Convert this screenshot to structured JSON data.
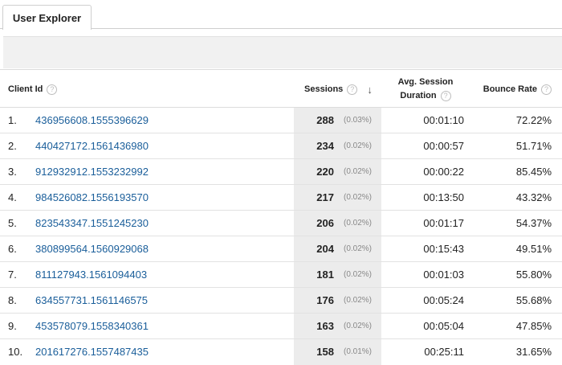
{
  "tabs": [
    {
      "label": "User Explorer"
    }
  ],
  "table": {
    "columns": {
      "client_id": "Client Id",
      "sessions": "Sessions",
      "avg_duration_line1": "Avg. Session",
      "avg_duration_line2": "Duration",
      "bounce_rate": "Bounce Rate"
    },
    "help_glyph": "?",
    "sort_glyph": "↓",
    "rows": [
      {
        "index": "1.",
        "client_id": "436956608.1555396629",
        "sessions": "288",
        "pct": "(0.03%)",
        "avg_duration": "00:01:10",
        "bounce_rate": "72.22%"
      },
      {
        "index": "2.",
        "client_id": "440427172.1561436980",
        "sessions": "234",
        "pct": "(0.02%)",
        "avg_duration": "00:00:57",
        "bounce_rate": "51.71%"
      },
      {
        "index": "3.",
        "client_id": "912932912.1553232992",
        "sessions": "220",
        "pct": "(0.02%)",
        "avg_duration": "00:00:22",
        "bounce_rate": "85.45%"
      },
      {
        "index": "4.",
        "client_id": "984526082.1556193570",
        "sessions": "217",
        "pct": "(0.02%)",
        "avg_duration": "00:13:50",
        "bounce_rate": "43.32%"
      },
      {
        "index": "5.",
        "client_id": "823543347.1551245230",
        "sessions": "206",
        "pct": "(0.02%)",
        "avg_duration": "00:01:17",
        "bounce_rate": "54.37%"
      },
      {
        "index": "6.",
        "client_id": "380899564.1560929068",
        "sessions": "204",
        "pct": "(0.02%)",
        "avg_duration": "00:15:43",
        "bounce_rate": "49.51%"
      },
      {
        "index": "7.",
        "client_id": "811127943.1561094403",
        "sessions": "181",
        "pct": "(0.02%)",
        "avg_duration": "00:01:03",
        "bounce_rate": "55.80%"
      },
      {
        "index": "8.",
        "client_id": "634557731.1561146575",
        "sessions": "176",
        "pct": "(0.02%)",
        "avg_duration": "00:05:24",
        "bounce_rate": "55.68%"
      },
      {
        "index": "9.",
        "client_id": "453578079.1558340361",
        "sessions": "163",
        "pct": "(0.02%)",
        "avg_duration": "00:05:04",
        "bounce_rate": "47.85%"
      },
      {
        "index": "10.",
        "client_id": "201617276.1557487435",
        "sessions": "158",
        "pct": "(0.01%)",
        "avg_duration": "00:25:11",
        "bounce_rate": "31.65%"
      }
    ]
  }
}
